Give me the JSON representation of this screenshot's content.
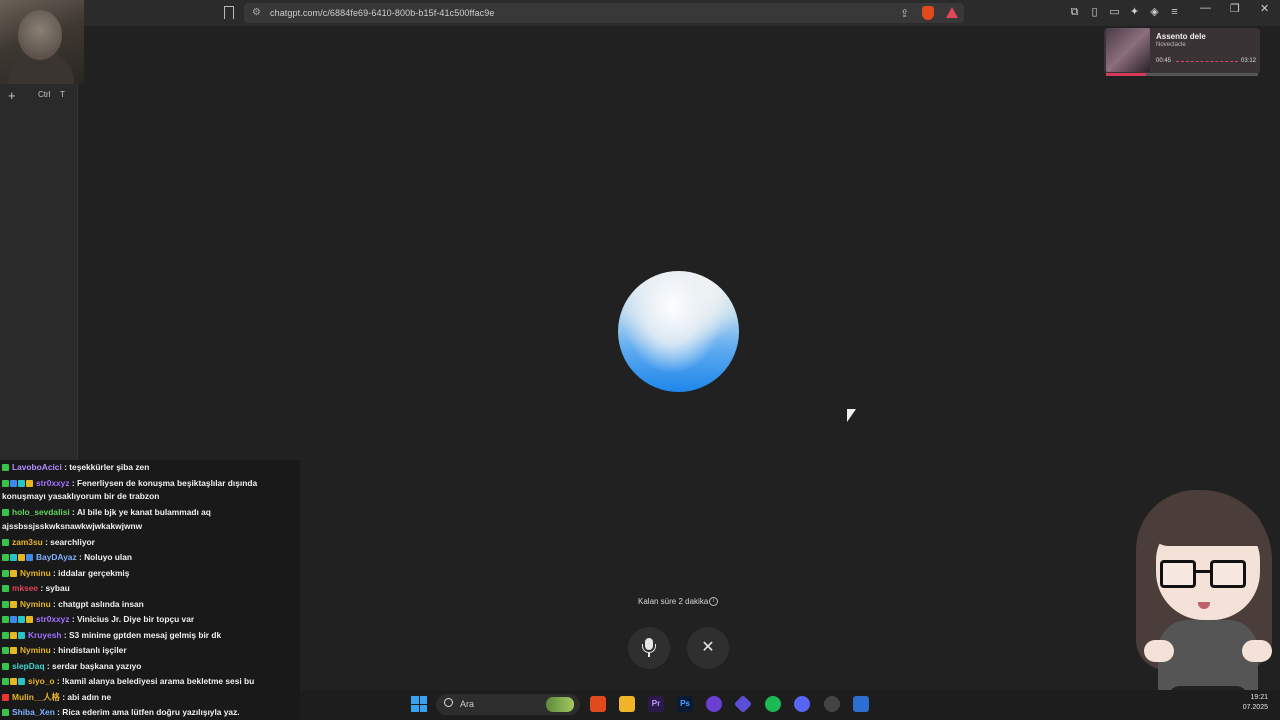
{
  "browser": {
    "url": "chatgpt.com/c/6884fe69-6410-800b-b15f-41c500ffac9e",
    "new_tab_symbol": "+",
    "shortcut_key_1": "Ctrl",
    "shortcut_key_2": "T"
  },
  "music_player": {
    "title": "Assento deIe",
    "artist": "Novectacle",
    "time_elapsed": "00:45",
    "time_total": "03:12"
  },
  "voice_mode": {
    "remaining_text": "Kalan süre 2 dakika",
    "info_symbol": "i",
    "close_symbol": "✕"
  },
  "chat": {
    "messages": [
      {
        "user": "LavoboAcici",
        "user_color": "#b48cff",
        "text": ": teşekkürler şiba zen"
      },
      {
        "user": "str0xxyz",
        "user_color": "#a070ff",
        "text": ": Fenerliysen de konuşma beşiktaşlılar dışında"
      },
      {
        "user": "",
        "user_color": "#f0f0f0",
        "text": "konuşmayı yasaklıyorum bir de trabzon"
      },
      {
        "user": "holo_sevdalisi",
        "user_color": "#5fd35f",
        "text": ": AI bile bjk ye kanat bulammadı aq"
      },
      {
        "user": "",
        "user_color": "#f0f0f0",
        "text": "ajssbssjsskwksnawkwjwkakwjwnw"
      },
      {
        "user": "zam3su",
        "user_color": "#e6b623",
        "text": ": searchliyor"
      },
      {
        "user": "BayDAyaz",
        "user_color": "#7fb0ff",
        "text": ": Noluyo ulan"
      },
      {
        "user": "Nyminu",
        "user_color": "#e6b623",
        "text": ": iddalar gerçekmiş"
      },
      {
        "user": "mksee",
        "user_color": "#e0405a",
        "text": ": sybau"
      },
      {
        "user": "Nyminu",
        "user_color": "#e6b623",
        "text": ": chatgpt aslında insan"
      },
      {
        "user": "str0xxyz",
        "user_color": "#a070ff",
        "text": ": Vinicius Jr. Diye bir topçu var"
      },
      {
        "user": "Kruyesh",
        "user_color": "#a070ff",
        "text": ": S3 minime gptden mesaj gelmiş bir dk"
      },
      {
        "user": "Nyminu",
        "user_color": "#e6b623",
        "text": ": hindistanlı işçiler"
      },
      {
        "user": "slepDaq",
        "user_color": "#3fd3d3",
        "text": ": serdar başkana yazıyo"
      },
      {
        "user": "siyo_o",
        "user_color": "#e6b623",
        "text": ": !kamil alanya belediyesi arama bekletme sesi bu"
      },
      {
        "user": "Mulin__人格",
        "user_color": "#e6b623",
        "text": ": abi adın ne"
      },
      {
        "user": "Shiba_Xen",
        "user_color": "#7fb0ff",
        "text": ": Rica ederim ama lütfen doğru yazılışıyla yaz."
      }
    ]
  },
  "taskbar": {
    "search_label": "Ara",
    "time": "19:21",
    "date": "07.2025"
  },
  "colors": {
    "background": "#212121",
    "orb_blue": "#1f86ea",
    "brave_orange": "#e14a1c"
  }
}
